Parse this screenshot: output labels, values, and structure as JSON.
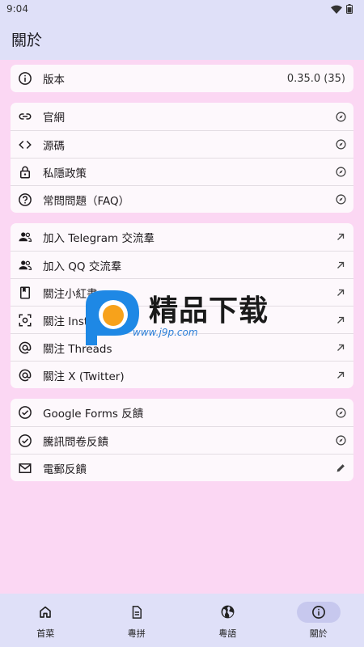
{
  "status_bar": {
    "time": "9:04"
  },
  "app_bar": {
    "title": "關於"
  },
  "sections": [
    {
      "rows": [
        {
          "icon": "info-icon",
          "label": "版本",
          "value": "0.35.0 (35)"
        }
      ]
    },
    {
      "rows": [
        {
          "icon": "link-icon",
          "label": "官網",
          "trail_icon": "compass-icon"
        },
        {
          "icon": "code-icon",
          "label": "源碼",
          "trail_icon": "compass-icon"
        },
        {
          "icon": "lock-icon",
          "label": "私隱政策",
          "trail_icon": "compass-icon"
        },
        {
          "icon": "help-icon",
          "label": "常問問題（FAQ）",
          "trail_icon": "compass-icon"
        }
      ]
    },
    {
      "rows": [
        {
          "icon": "group-icon",
          "label": "加入 Telegram 交流羣",
          "trail_icon": "arrow-up-right-icon"
        },
        {
          "icon": "group-icon",
          "label": "加入 QQ 交流羣",
          "trail_icon": "arrow-up-right-icon"
        },
        {
          "icon": "bookmark-book-icon",
          "label": "關注小紅書",
          "trail_icon": "arrow-up-right-icon"
        },
        {
          "icon": "scan-icon",
          "label": "關注 Instagram",
          "trail_icon": "arrow-up-right-icon"
        },
        {
          "icon": "at-icon",
          "label": "關注 Threads",
          "trail_icon": "arrow-up-right-icon"
        },
        {
          "icon": "at-icon",
          "label": "關注 X (Twitter)",
          "trail_icon": "arrow-up-right-icon"
        }
      ]
    },
    {
      "rows": [
        {
          "icon": "check-circle-icon",
          "label": "Google Forms 反饋",
          "trail_icon": "compass-icon"
        },
        {
          "icon": "check-circle-icon",
          "label": "騰訊問卷反饋",
          "trail_icon": "compass-icon"
        },
        {
          "icon": "mail-icon",
          "label": "電郵反饋",
          "trail_icon": "pencil-icon"
        }
      ]
    }
  ],
  "watermark": {
    "title": "精品下载",
    "url": "www.j9p.com"
  },
  "nav": [
    {
      "icon": "home-icon",
      "label": "首菜",
      "active": false
    },
    {
      "icon": "document-icon",
      "label": "粵拼",
      "active": false
    },
    {
      "icon": "globe-icon",
      "label": "粵語",
      "active": false
    },
    {
      "icon": "info-icon",
      "label": "關於",
      "active": true
    }
  ],
  "colors": {
    "background": "#fbd7f3",
    "bar": "#dfe0f8",
    "card": "#fdf8fc",
    "nav_active": "#c7c8ee"
  }
}
